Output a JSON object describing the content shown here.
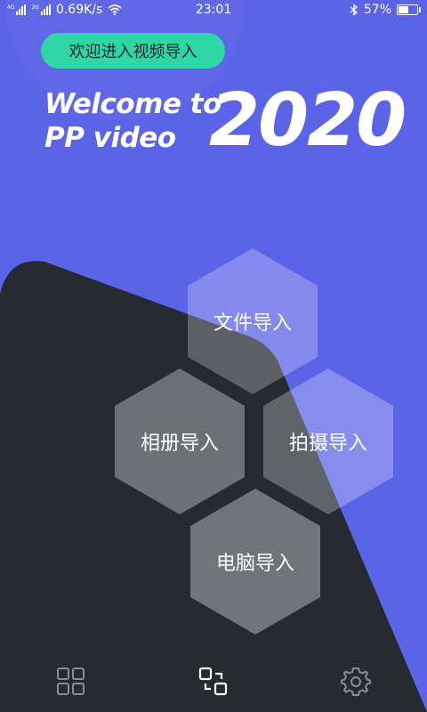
{
  "status_bar": {
    "signal1_label": "4G",
    "signal2_label": "2G",
    "speed": "0.69K/s",
    "time": "23:01",
    "battery_text": "57%",
    "battery_level": 0.57
  },
  "header": {
    "pill_label": "欢迎进入视频导入",
    "title_line1": "Welcome to",
    "title_line2": "PP video",
    "year": "2020"
  },
  "import_options": {
    "file": "文件导入",
    "album": "相册导入",
    "camera": "拍摄导入",
    "computer": "电脑导入"
  },
  "bottom_nav": {
    "items": [
      "grid-icon",
      "swap-icon",
      "gear-icon"
    ],
    "active": "swap-icon"
  },
  "colors": {
    "background": "#5b63e6",
    "dark_panel": "#262a31",
    "pill": "#2fd6a6"
  }
}
